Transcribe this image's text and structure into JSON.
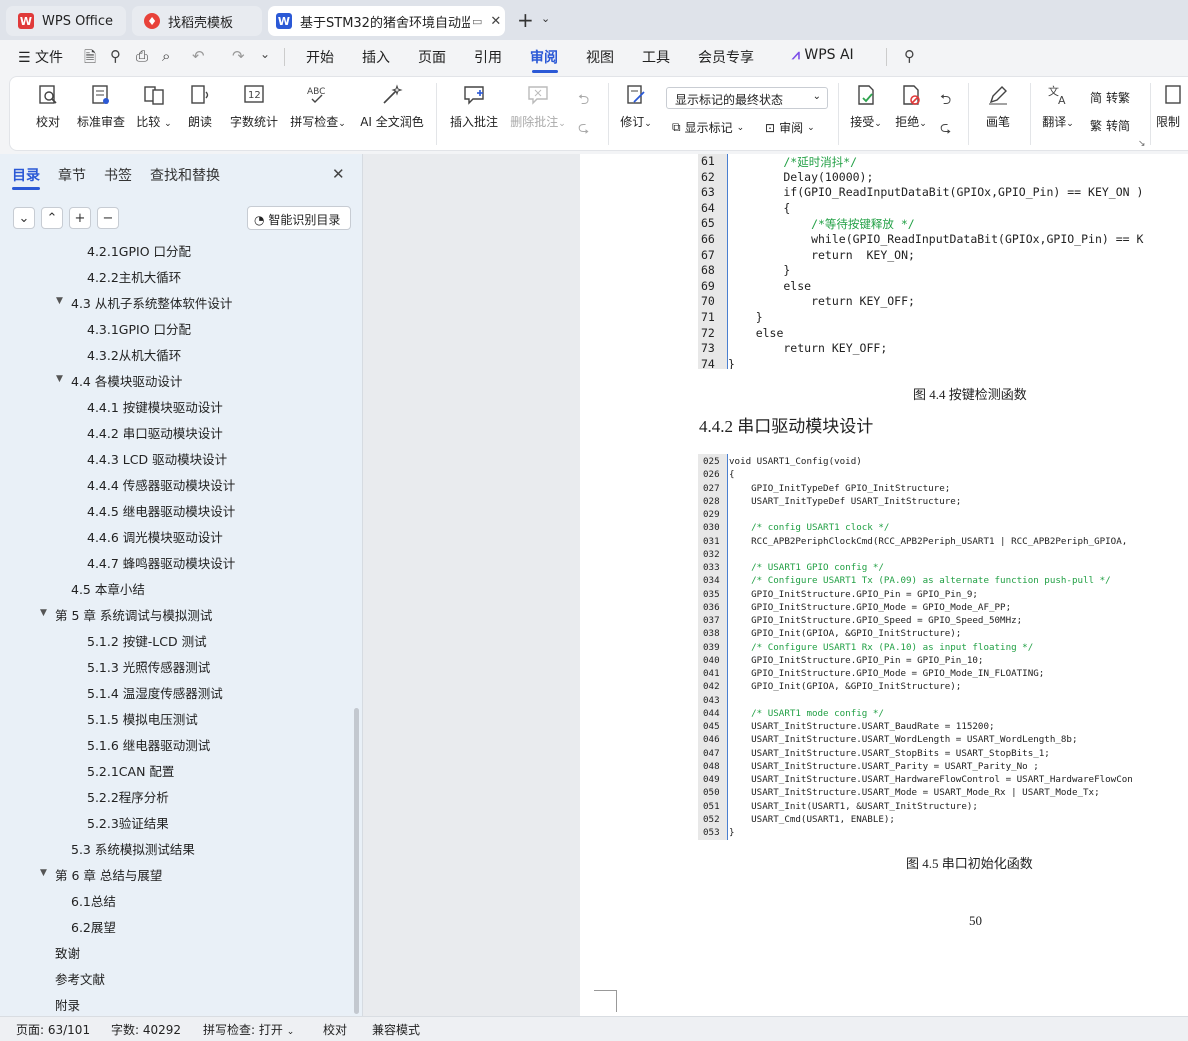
{
  "tabs": [
    {
      "label": "WPS Office",
      "icon": "wps-logo-icon"
    },
    {
      "label": "找稻壳模板",
      "icon": "docer-icon"
    },
    {
      "label": "基于STM32的猪舍环境自动监",
      "icon": "word-doc-icon"
    }
  ],
  "menu": {
    "file": "文件",
    "items": [
      "开始",
      "插入",
      "页面",
      "引用",
      "审阅",
      "视图",
      "工具",
      "会员专享"
    ],
    "active": "审阅",
    "ai": "WPS AI"
  },
  "ribbon": {
    "proof": "校对",
    "std_review": "标准审查",
    "compare": "比较",
    "read": "朗读",
    "wordcount": "字数统计",
    "spell": "拼写检查",
    "ai_polish": "AI 全文润色",
    "insert_comment": "插入批注",
    "delete_comment": "删除批注",
    "revise": "修订",
    "markup_select": "显示标记的最终状态",
    "show_markup": "显示标记",
    "review": "审阅",
    "accept": "接受",
    "reject": "拒绝",
    "pen": "画笔",
    "translate": "翻译",
    "to_trad": "转繁",
    "to_simp": "转简",
    "restrict": "限制"
  },
  "sidebar": {
    "tabs": [
      "目录",
      "章节",
      "书签",
      "查找和替换"
    ],
    "smart_btn": "智能识别目录",
    "toc": [
      {
        "t": "4.2.1GPIO 口分配",
        "lvl": 3
      },
      {
        "t": "4.2.2主机大循环",
        "lvl": 3
      },
      {
        "t": "4.3  从机子系统整体软件设计",
        "lvl": 2,
        "exp": true
      },
      {
        "t": "4.3.1GPIO 口分配",
        "lvl": 3
      },
      {
        "t": "4.3.2从机大循环",
        "lvl": 3
      },
      {
        "t": "4.4  各模块驱动设计",
        "lvl": 2,
        "exp": true
      },
      {
        "t": "4.4.1 按键模块驱动设计",
        "lvl": 3
      },
      {
        "t": "4.4.2 串口驱动模块设计",
        "lvl": 3
      },
      {
        "t": "4.4.3 LCD 驱动模块设计",
        "lvl": 3
      },
      {
        "t": "4.4.4 传感器驱动模块设计",
        "lvl": 3
      },
      {
        "t": "4.4.5 继电器驱动模块设计",
        "lvl": 3
      },
      {
        "t": "4.4.6 调光模块驱动设计",
        "lvl": 3
      },
      {
        "t": "4.4.7 蜂鸣器驱动模块设计",
        "lvl": 3
      },
      {
        "t": "4.5  本章小结",
        "lvl": 2
      },
      {
        "t": "第 5 章  系统调试与模拟测试",
        "lvl": 1,
        "exp": true
      },
      {
        "t": "5.1.2 按键-LCD 测试",
        "lvl": 3
      },
      {
        "t": "5.1.3 光照传感器测试",
        "lvl": 3
      },
      {
        "t": "5.1.4 温湿度传感器测试",
        "lvl": 3
      },
      {
        "t": "5.1.5 模拟电压测试",
        "lvl": 3
      },
      {
        "t": "5.1.6 继电器驱动测试",
        "lvl": 3
      },
      {
        "t": "5.2.1CAN 配置",
        "lvl": 3
      },
      {
        "t": "5.2.2程序分析",
        "lvl": 3
      },
      {
        "t": "5.2.3验证结果",
        "lvl": 3
      },
      {
        "t": "5.3  系统模拟测试结果",
        "lvl": 2
      },
      {
        "t": "第 6 章  总结与展望",
        "lvl": 1,
        "exp": true
      },
      {
        "t": "6.1总结",
        "lvl": 2
      },
      {
        "t": "6.2展望",
        "lvl": 2
      },
      {
        "t": "致谢",
        "lvl": 1
      },
      {
        "t": "参考文献",
        "lvl": 1
      },
      {
        "t": "附录",
        "lvl": 1
      }
    ]
  },
  "doc": {
    "code1": [
      [
        "61",
        "        /*延时消抖*/"
      ],
      [
        "62",
        "        Delay(10000);"
      ],
      [
        "63",
        "        if(GPIO_ReadInputDataBit(GPIOx,GPIO_Pin) == KEY_ON )"
      ],
      [
        "64",
        "        {"
      ],
      [
        "65",
        "            /*等待按键释放 */"
      ],
      [
        "66",
        "            while(GPIO_ReadInputDataBit(GPIOx,GPIO_Pin) == K"
      ],
      [
        "67",
        "            return  KEY_ON;"
      ],
      [
        "68",
        "        }"
      ],
      [
        "69",
        "        else"
      ],
      [
        "70",
        "            return KEY_OFF;"
      ],
      [
        "71",
        "    }"
      ],
      [
        "72",
        "    else"
      ],
      [
        "73",
        "        return KEY_OFF;"
      ],
      [
        "74",
        "}"
      ]
    ],
    "caption1": "图 4.4  按键检测函数",
    "heading": "4.4.2 串口驱动模块设计",
    "code2": [
      [
        "025",
        "void USART1_Config(void)"
      ],
      [
        "026",
        "{"
      ],
      [
        "027",
        "    GPIO_InitTypeDef GPIO_InitStructure;"
      ],
      [
        "028",
        "    USART_InitTypeDef USART_InitStructure;"
      ],
      [
        "029",
        ""
      ],
      [
        "030",
        "    /* config USART1 clock */"
      ],
      [
        "031",
        "    RCC_APB2PeriphClockCmd(RCC_APB2Periph_USART1 | RCC_APB2Periph_GPIOA,"
      ],
      [
        "032",
        ""
      ],
      [
        "033",
        "    /* USART1 GPIO config */"
      ],
      [
        "034",
        "    /* Configure USART1 Tx (PA.09) as alternate function push-pull */"
      ],
      [
        "035",
        "    GPIO_InitStructure.GPIO_Pin = GPIO_Pin_9;"
      ],
      [
        "036",
        "    GPIO_InitStructure.GPIO_Mode = GPIO_Mode_AF_PP;"
      ],
      [
        "037",
        "    GPIO_InitStructure.GPIO_Speed = GPIO_Speed_50MHz;"
      ],
      [
        "038",
        "    GPIO_Init(GPIOA, &GPIO_InitStructure);"
      ],
      [
        "039",
        "    /* Configure USART1 Rx (PA.10) as input floating */"
      ],
      [
        "040",
        "    GPIO_InitStructure.GPIO_Pin = GPIO_Pin_10;"
      ],
      [
        "041",
        "    GPIO_InitStructure.GPIO_Mode = GPIO_Mode_IN_FLOATING;"
      ],
      [
        "042",
        "    GPIO_Init(GPIOA, &GPIO_InitStructure);"
      ],
      [
        "043",
        ""
      ],
      [
        "044",
        "    /* USART1 mode config */"
      ],
      [
        "045",
        "    USART_InitStructure.USART_BaudRate = 115200;"
      ],
      [
        "046",
        "    USART_InitStructure.USART_WordLength = USART_WordLength_8b;"
      ],
      [
        "047",
        "    USART_InitStructure.USART_StopBits = USART_StopBits_1;"
      ],
      [
        "048",
        "    USART_InitStructure.USART_Parity = USART_Parity_No ;"
      ],
      [
        "049",
        "    USART_InitStructure.USART_HardwareFlowControl = USART_HardwareFlowCon"
      ],
      [
        "050",
        "    USART_InitStructure.USART_Mode = USART_Mode_Rx | USART_Mode_Tx;"
      ],
      [
        "051",
        "    USART_Init(USART1, &USART_InitStructure);"
      ],
      [
        "052",
        "    USART_Cmd(USART1, ENABLE);"
      ],
      [
        "053",
        "}"
      ]
    ],
    "caption2": "图 4.5  串口初始化函数",
    "page_number": "50"
  },
  "status": {
    "page": "页面: 63/101",
    "words": "字数: 40292",
    "spell": "拼写检查: 打开",
    "proof": "校对",
    "compat": "兼容模式"
  },
  "colors": {
    "accent": "#2b59d6",
    "wps_red": "#e03a3a",
    "comment_green": "#22a045",
    "keyword": "#b8860b"
  }
}
